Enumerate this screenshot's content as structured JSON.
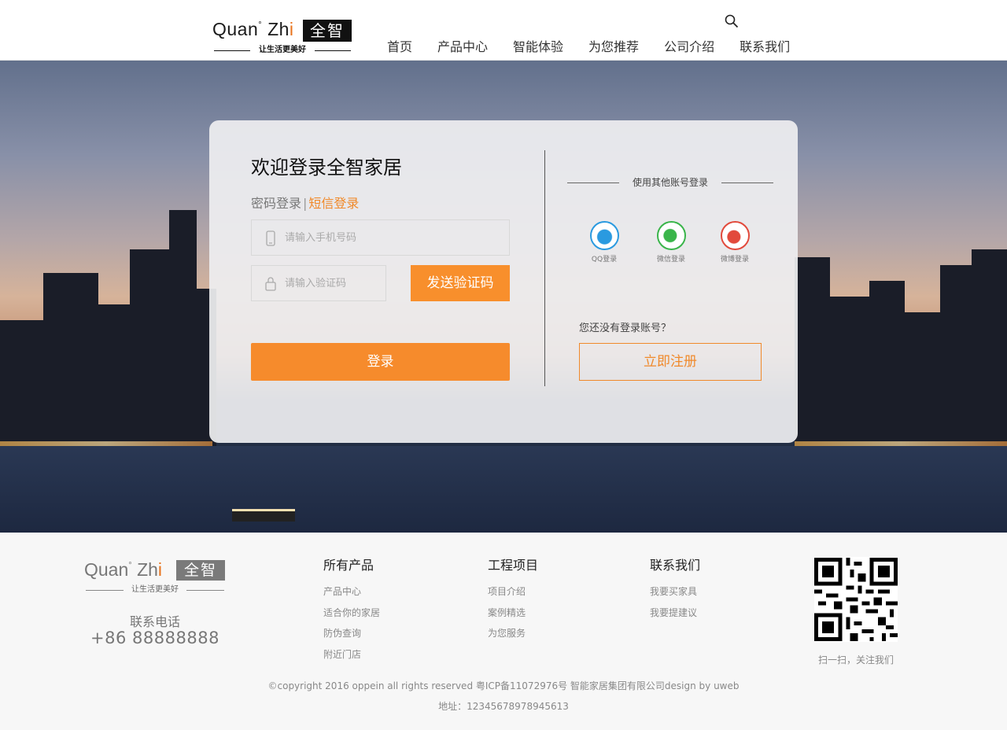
{
  "header": {
    "logo": {
      "en": "Quan",
      "deg": "°",
      "zh_prefix": "Zh",
      "zh_i": "i",
      "box": "全智",
      "slogan": "让生活更美好"
    },
    "nav": [
      "首页",
      "产品中心",
      "智能体验",
      "为您推荐",
      "公司介绍",
      "联系我们"
    ]
  },
  "login": {
    "title": "欢迎登录全智家居",
    "tab_password": "密码登录",
    "tab_separator": "|",
    "tab_sms": "短信登录",
    "phone_placeholder": "请输入手机号码",
    "code_placeholder": "请输入验证码",
    "send_code": "发送验证码",
    "submit": "登录",
    "other_title": "使用其他账号登录",
    "social": [
      {
        "label": "QQ登录",
        "icon": "qq-icon",
        "color": "#2a9ae0"
      },
      {
        "label": "微信登录",
        "icon": "wechat-icon",
        "color": "#3ab54a"
      },
      {
        "label": "微博登录",
        "icon": "weibo-icon",
        "color": "#e24a3c"
      }
    ],
    "no_account": "您还没有登录账号？",
    "register": "立即注册"
  },
  "colors": {
    "accent": "#f68b2c"
  },
  "footer": {
    "logo": {
      "en": "Quan",
      "deg": "°",
      "zh_prefix": "Zh",
      "zh_i": "i",
      "box": "全智",
      "slogan": "让生活更美好"
    },
    "tel_label": "联系电话",
    "tel": "+86  88888888",
    "columns": [
      {
        "title": "所有产品",
        "links": [
          "产品中心",
          "适合你的家居",
          "防伪查询",
          "附近门店"
        ]
      },
      {
        "title": "工程项目",
        "links": [
          "项目介绍",
          "案例精选",
          "为您服务"
        ]
      },
      {
        "title": "联系我们",
        "links": [
          "我要买家具",
          "我要提建议"
        ]
      }
    ],
    "qr_caption": "扫一扫，关注我们",
    "copyright": "©copyright 2016 oppein all rights reserved 粤ICP备11072976号 智能家居集团有限公司design by uweb",
    "address": "地址：12345678978945613"
  }
}
